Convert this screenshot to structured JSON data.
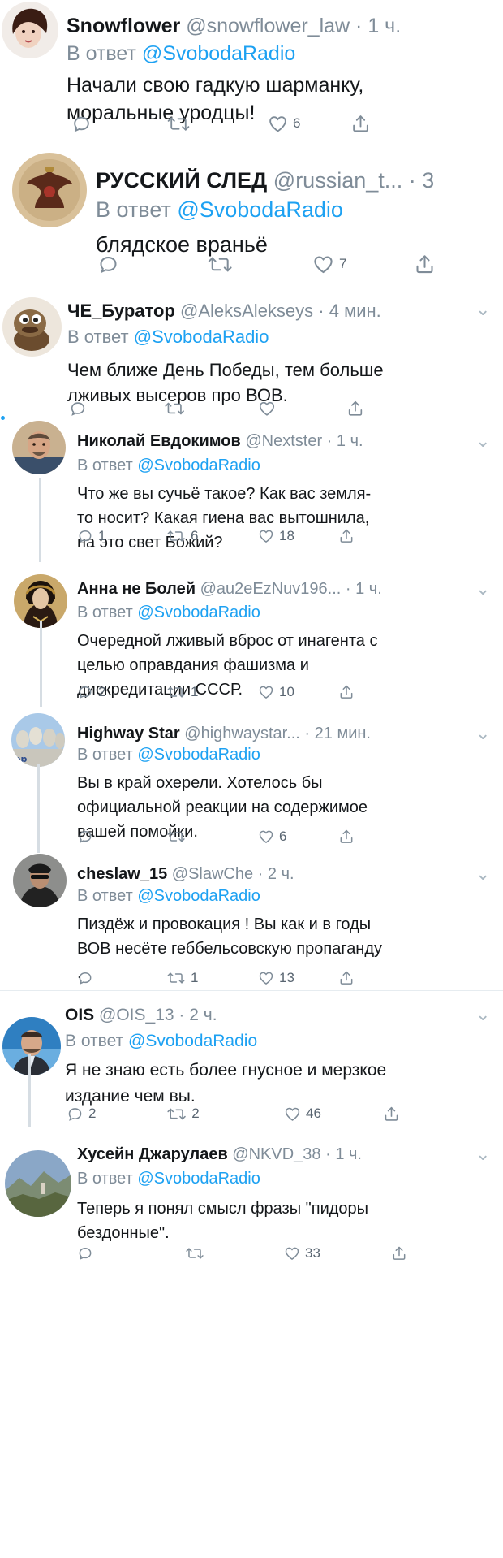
{
  "colors": {
    "link": "#1da1f2",
    "muted": "#7f8c98",
    "text": "#14171a",
    "thread": "#d6dde3"
  },
  "tweets": [
    {
      "name": "Snowflower",
      "handle": "@snowflower_law",
      "time": "· 1 ч.",
      "reply_prefix": "В ответ",
      "reply_to": "@SvobodaRadio",
      "lines": [
        "Начали свою гадкую шарманку,",
        "моральные уродцы!"
      ],
      "counts": {
        "reply": "",
        "retweet": "",
        "like": "6"
      },
      "avatar": "woman-portrait"
    },
    {
      "name": "РУССКИЙ СЛЕД",
      "handle": "@russian_t...",
      "time": "· 3",
      "reply_prefix": "В ответ",
      "reply_to": "@SvobodaRadio",
      "lines": [
        "блядское враньё"
      ],
      "counts": {
        "reply": "",
        "retweet": "",
        "like": "7"
      },
      "avatar": "eagle-emblem"
    },
    {
      "name": "ЧЕ_Буратор",
      "handle": "@AleksAlekseys",
      "time": "· 4 мин.",
      "reply_prefix": "В ответ",
      "reply_to": "@SvobodaRadio",
      "lines": [
        "Чем ближе День Победы, тем больше",
        "лживых высеров про ВОВ."
      ],
      "counts": {
        "reply": "",
        "retweet": "",
        "like": ""
      },
      "avatar": "puppet"
    },
    {
      "name": "Николай Евдокимов",
      "handle": "@Nextster",
      "time": "· 1 ч.",
      "reply_prefix": "В ответ",
      "reply_to": "@SvobodaRadio",
      "lines": [
        "Что же вы сучьё такое? Как вас земля-",
        "то носит? Какая гиена вас вытошнила,",
        "на это свет Божий?"
      ],
      "counts": {
        "reply": "1",
        "retweet": "6",
        "like": "18"
      },
      "avatar": "man-portrait"
    },
    {
      "name": "Анна не Болей",
      "handle": "@au2eEzNuv196...",
      "time": "· 1 ч.",
      "reply_prefix": "В ответ",
      "reply_to": "@SvobodaRadio",
      "lines": [
        "Очередной лживый вброс от инагента с",
        "целью оправдания фашизма и",
        "дискредитации СССР."
      ],
      "counts": {
        "reply": "2",
        "retweet": "1",
        "like": "10"
      },
      "avatar": "painted-portrait"
    },
    {
      "name": "Highway Star",
      "handle": "@highwaystar...",
      "time": "· 21 мин.",
      "reply_prefix": "В ответ",
      "reply_to": "@SvobodaRadio",
      "lines": [
        "Вы в край охерели. Хотелось бы",
        "официальной реакции на содержимое",
        "вашей помойки."
      ],
      "counts": {
        "reply": "",
        "retweet": "",
        "like": "6"
      },
      "avatar": "rock-band"
    },
    {
      "name": "cheslaw_15",
      "handle": "@SlawChe",
      "time": "· 2 ч.",
      "reply_prefix": "В ответ",
      "reply_to": "@SvobodaRadio",
      "lines": [
        "Пиздёж и провокация ! Вы как и в годы",
        "ВОВ несёте геббельсовскую пропаганду",
        "."
      ],
      "counts": {
        "reply": "",
        "retweet": "1",
        "like": "13"
      },
      "avatar": "man-dark"
    },
    {
      "name": "OIS",
      "handle": "@OIS_13",
      "time": "· 2 ч.",
      "reply_prefix": "В ответ",
      "reply_to": "@SvobodaRadio",
      "lines": [
        "Я не знаю есть более гнусное и мерзкое",
        "издание чем вы."
      ],
      "counts": {
        "reply": "2",
        "retweet": "2",
        "like": "46"
      },
      "avatar": "man-suit"
    },
    {
      "name": "Хусейн Джарулаев",
      "handle": "@NKVD_38",
      "time": "· 1 ч.",
      "reply_prefix": "В ответ",
      "reply_to": "@SvobodaRadio",
      "lines": [
        "Теперь я понял смысл фразы \"пидоры",
        "бездонные\"."
      ],
      "counts": {
        "reply": "",
        "retweet": "",
        "like": "33"
      },
      "avatar": "landscape"
    }
  ]
}
